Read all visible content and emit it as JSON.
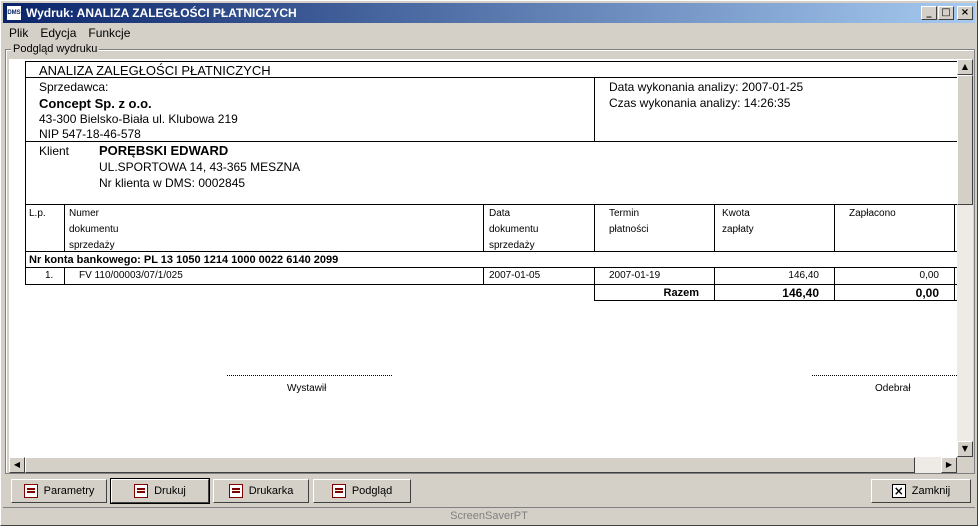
{
  "window": {
    "title": "Wydruk: ANALIZA ZALEGŁOŚCI PŁATNICZYCH",
    "app_icon": "DMS"
  },
  "menu": [
    "Plik",
    "Edycja",
    "Funkcje"
  ],
  "group_label": "Podgląd wydruku",
  "report": {
    "title": "ANALIZA ZALEGŁOŚCI PŁATNICZYCH",
    "seller_label": "Sprzedawca:",
    "seller_name": "Concept Sp. z o.o.",
    "seller_address": "43-300 Bielsko-Biała ul. Klubowa 219",
    "seller_nip": "NIP 547-18-46-578",
    "analysis_date": "Data wykonania analizy: 2007-01-25",
    "analysis_time": "Czas wykonania analizy: 14:26:35",
    "client_label": "Klient",
    "client_name": "PORĘBSKI EDWARD",
    "client_address": "UL.SPORTOWA 14, 43-365 MESZNA",
    "client_number": "Nr klienta w DMS: 0002845",
    "columns": {
      "lp": "L.p.",
      "doc1": "Numer",
      "doc2": "dokumentu",
      "doc3": "sprzedaży",
      "date1": "Data",
      "date2": "dokumentu",
      "date3": "sprzedaży",
      "term1": "Termin",
      "term2": "płatności",
      "amount1": "Kwota",
      "amount2": "zapłaty",
      "paid": "Zapłacono"
    },
    "bank_account": "Nr konta bankowego: PL  13 1050 1214 1000 0022 6140 2099",
    "rows": [
      {
        "lp": "1.",
        "doc": "FV 110/00003/07/1/025",
        "date": "2007-01-05",
        "term": "2007-01-19",
        "amount": "146,40",
        "paid": "0,00"
      }
    ],
    "total_label": "Razem",
    "total_amount": "146,40",
    "total_paid": "0,00",
    "sign_issued": "Wystawił",
    "sign_received": "Odebrał"
  },
  "buttons": {
    "params": "Parametry",
    "print": "Drukuj",
    "printer": "Drukarka",
    "preview": "Podgląd",
    "close": "Zamknij"
  },
  "status": "ScreenSaverPT"
}
